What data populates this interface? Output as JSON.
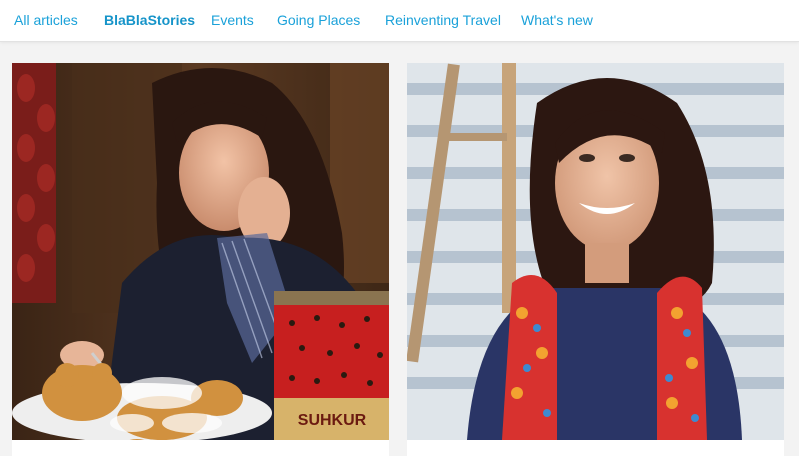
{
  "nav": {
    "items": [
      {
        "label": "All articles",
        "active": false
      },
      {
        "label": "BlaBlaStories",
        "active": true
      },
      {
        "label": "Events",
        "active": false
      },
      {
        "label": "Going Places",
        "active": false
      },
      {
        "label": "Reinventing Travel",
        "active": false
      },
      {
        "label": "What's new",
        "active": false
      }
    ]
  },
  "cards": [
    {
      "image": {
        "icon": "photo-girl-with-teddy-bear-cake",
        "tin_label": "SUHKUR"
      }
    },
    {
      "image": {
        "icon": "photo-smiling-woman-with-scarf"
      }
    }
  ],
  "colors": {
    "accent": "#1aa1d9",
    "page_background": "#f3f3f3",
    "card_background": "#ffffff"
  }
}
